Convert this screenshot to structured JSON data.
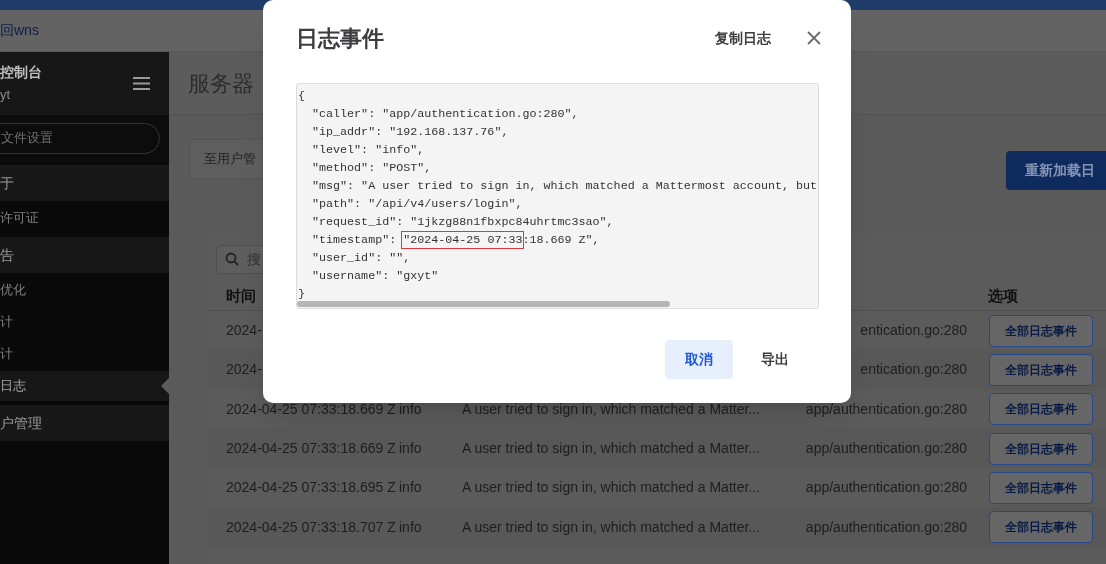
{
  "top_bar": {
    "link": "回wns"
  },
  "sidebar": {
    "title": "控制台",
    "user": "yt",
    "search": {
      "placeholder": "文件设置"
    },
    "items": [
      {
        "label": "于",
        "kind": "section",
        "selected": false
      },
      {
        "label": "许可证",
        "kind": "item",
        "selected": false
      },
      {
        "label": "告",
        "kind": "section",
        "selected": false
      },
      {
        "label": "优化",
        "kind": "item",
        "selected": false
      },
      {
        "label": "计",
        "kind": "item",
        "selected": false
      },
      {
        "label": "计",
        "kind": "item",
        "selected": false
      },
      {
        "label": "日志",
        "kind": "item",
        "selected": true
      },
      {
        "label": "户管理",
        "kind": "section",
        "selected": false
      }
    ]
  },
  "page": {
    "title": "服务器",
    "back_link": "至用户管",
    "reload_button": "重新加载日",
    "search": {
      "placeholder": "搜"
    },
    "table": {
      "columns": [
        {
          "label": "时间",
          "kind": "time"
        },
        {
          "label": "选项",
          "kind": "action"
        }
      ],
      "rows": [
        {
          "time": "2024-",
          "caller": "entication.go:280",
          "action": "全部日志事件"
        },
        {
          "time": "2024-",
          "caller": "entication.go:280",
          "action": "全部日志事件"
        },
        {
          "time": "2024-04-25 07:33:18.669 Z",
          "level": "info",
          "msg": "A user tried to sign in, which matched a Matter...",
          "caller": "app/authentication.go:280",
          "action": "全部日志事件"
        },
        {
          "time": "2024-04-25 07:33:18.669 Z",
          "level": "info",
          "msg": "A user tried to sign in, which matched a Matter...",
          "caller": "app/authentication.go:280",
          "action": "全部日志事件"
        },
        {
          "time": "2024-04-25 07:33:18.695 Z",
          "level": "info",
          "msg": "A user tried to sign in, which matched a Matter...",
          "caller": "app/authentication.go:280",
          "action": "全部日志事件"
        },
        {
          "time": "2024-04-25 07:33:18.707 Z",
          "level": "info",
          "msg": "A user tried to sign in, which matched a Matter...",
          "caller": "app/authentication.go:280",
          "action": "全部日志事件"
        }
      ]
    }
  },
  "dialog": {
    "title": "日志事件",
    "copy_button": "复制日志",
    "code_lines": [
      "{",
      "  \"caller\": \"app/authentication.go:280\",",
      "  \"ip_addr\": \"192.168.137.76\",",
      "  \"level\": \"info\",",
      "  \"method\": \"POST\",",
      "  \"msg\": \"A user tried to sign in, which matched a Mattermost account, but",
      "  \"path\": \"/api/v4/users/login\",",
      "  \"request_id\": \"1jkzg88n1fbxpc84uhrtmc3sao\",",
      "  \"timestamp\": \"2024-04-25 07:33:18.669 Z\",",
      "  \"user_id\": \"\",",
      "  \"username\": \"gxyt\"",
      "}"
    ],
    "buttons": [
      {
        "label": "取消",
        "kind": "primary"
      },
      {
        "label": "导出",
        "kind": "plain"
      }
    ]
  }
}
